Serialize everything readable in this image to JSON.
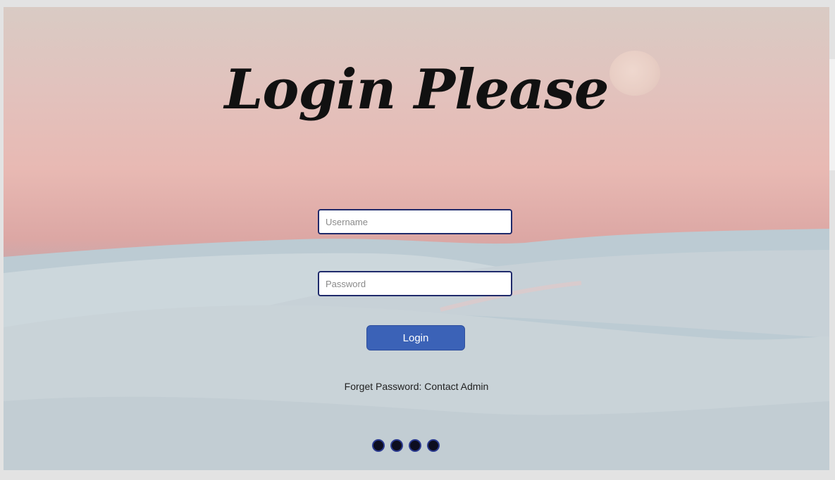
{
  "page": {
    "title": "Login Please"
  },
  "form": {
    "username": {
      "value": "",
      "placeholder": "Username"
    },
    "password": {
      "value": "",
      "placeholder": "Password"
    },
    "login_label": "Login",
    "forget_text": "Forget Password: Contact Admin"
  },
  "carousel": {
    "dot_count": 4
  },
  "colors": {
    "button": "#3b62b7",
    "field_border": "#1f2a6b",
    "dot": "#0d0d1f"
  }
}
